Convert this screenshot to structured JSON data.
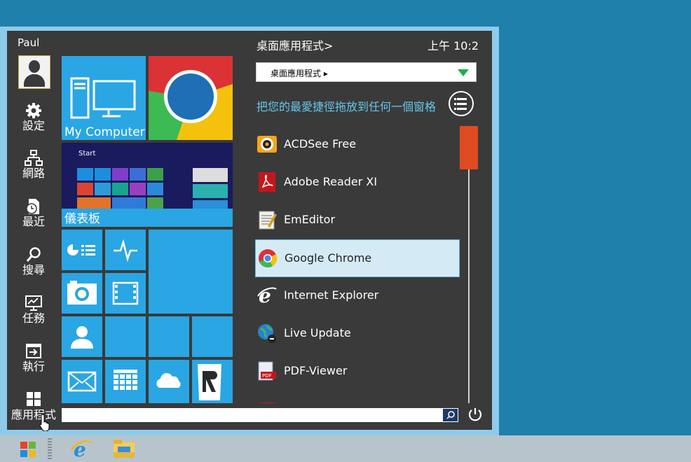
{
  "user": {
    "name": "Paul"
  },
  "sidebar": {
    "items": [
      {
        "label": "設定"
      },
      {
        "label": "網路"
      },
      {
        "label": "最近"
      },
      {
        "label": "搜尋"
      },
      {
        "label": "任務"
      },
      {
        "label": "執行"
      },
      {
        "label": "應用程式"
      }
    ]
  },
  "tiles": {
    "my_computer": "My Computer",
    "dashboard": "儀表板",
    "start_preview": "Start"
  },
  "panel": {
    "title": "桌面應用程式>",
    "time": "上午 10:2",
    "dropdown_value": "桌面應用程式 ▸",
    "hint": "把您的最愛捷徑拖放到任何一個窗格"
  },
  "apps": [
    {
      "label": "ACDSee Free",
      "icon": "acdsee-icon"
    },
    {
      "label": "Adobe Reader XI",
      "icon": "adobe-reader-icon"
    },
    {
      "label": "EmEditor",
      "icon": "emeditor-icon"
    },
    {
      "label": "Google Chrome",
      "icon": "chrome-icon",
      "selected": true
    },
    {
      "label": "Internet Explorer",
      "icon": "ie-icon"
    },
    {
      "label": "Live Update",
      "icon": "live-update-icon"
    },
    {
      "label": "PDF-Viewer",
      "icon": "pdf-viewer-icon"
    }
  ],
  "colors": {
    "tile_blue": "#29a6e3",
    "menu_bg": "#3a3a3a",
    "accent_cyan": "#66c7e9",
    "scroll_thumb": "#e04a21"
  }
}
